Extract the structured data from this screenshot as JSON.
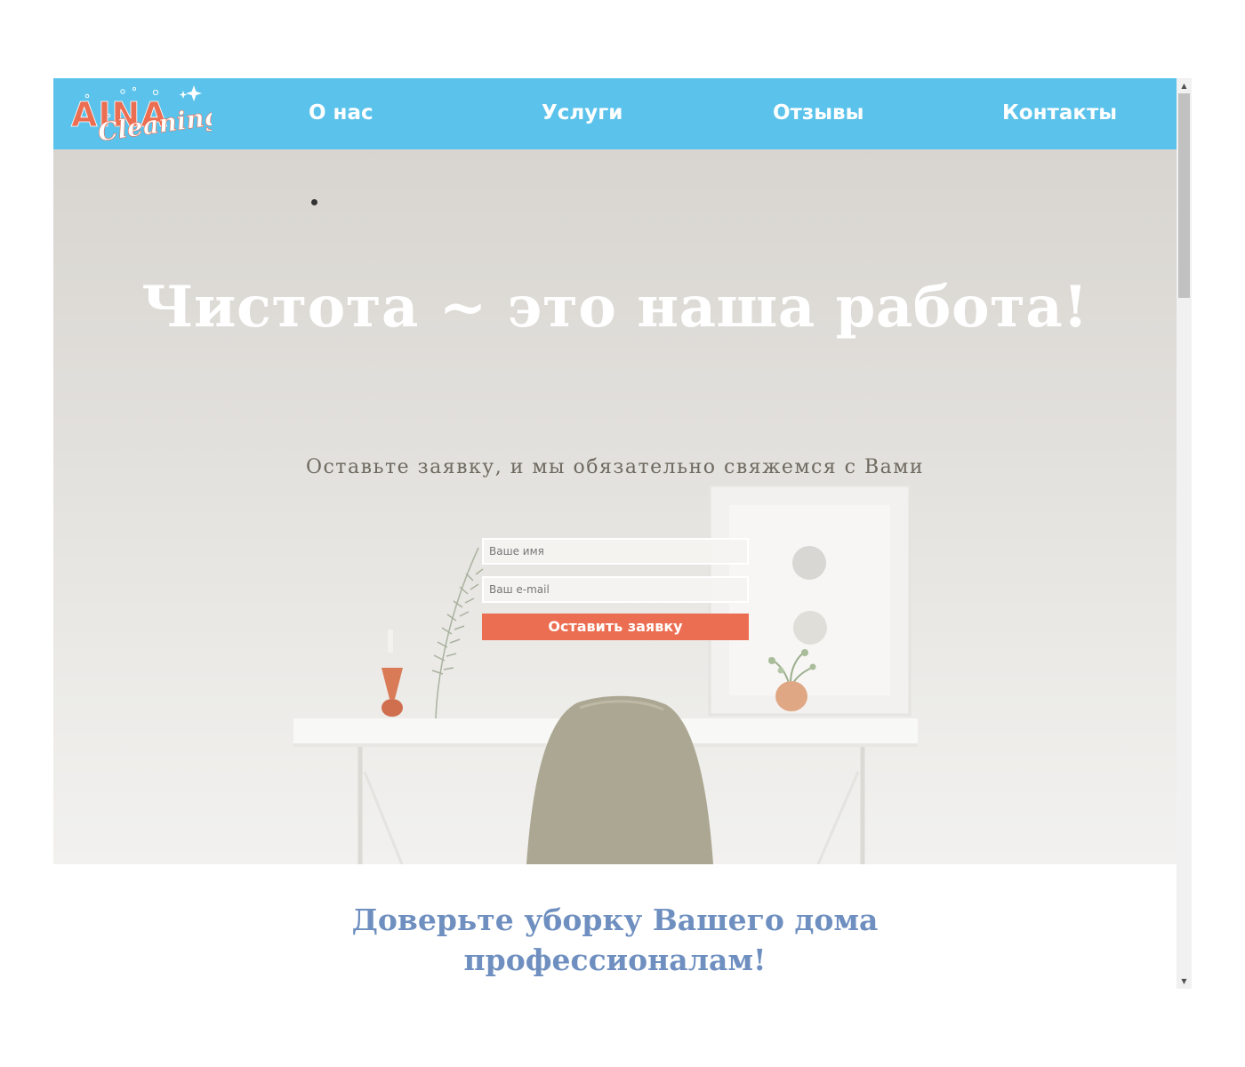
{
  "header": {
    "logo": {
      "word_top": "AINA",
      "word_script": "Cleaning"
    },
    "nav": [
      {
        "label": "О нас"
      },
      {
        "label": "Услуги"
      },
      {
        "label": "Отзывы"
      },
      {
        "label": "Контакты"
      }
    ]
  },
  "hero": {
    "title": "Чистота ~ это наша работа!",
    "subtitle": "Оставьте заявку, и мы обязательно свяжемся с Вами",
    "form": {
      "name_placeholder": "Ваше имя",
      "email_placeholder": "Ваш e-mail",
      "submit_label": "Оставить заявку"
    }
  },
  "trust": {
    "title_line1": "Доверьте уборку Вашего дома",
    "title_line2": "профессионалам!"
  },
  "scrollbar": {
    "up_icon": "▲",
    "down_icon": "▼"
  },
  "colors": {
    "header_bg": "#5bc3eb",
    "accent": "#ec6e52",
    "trust_title": "#6e8fbf"
  }
}
